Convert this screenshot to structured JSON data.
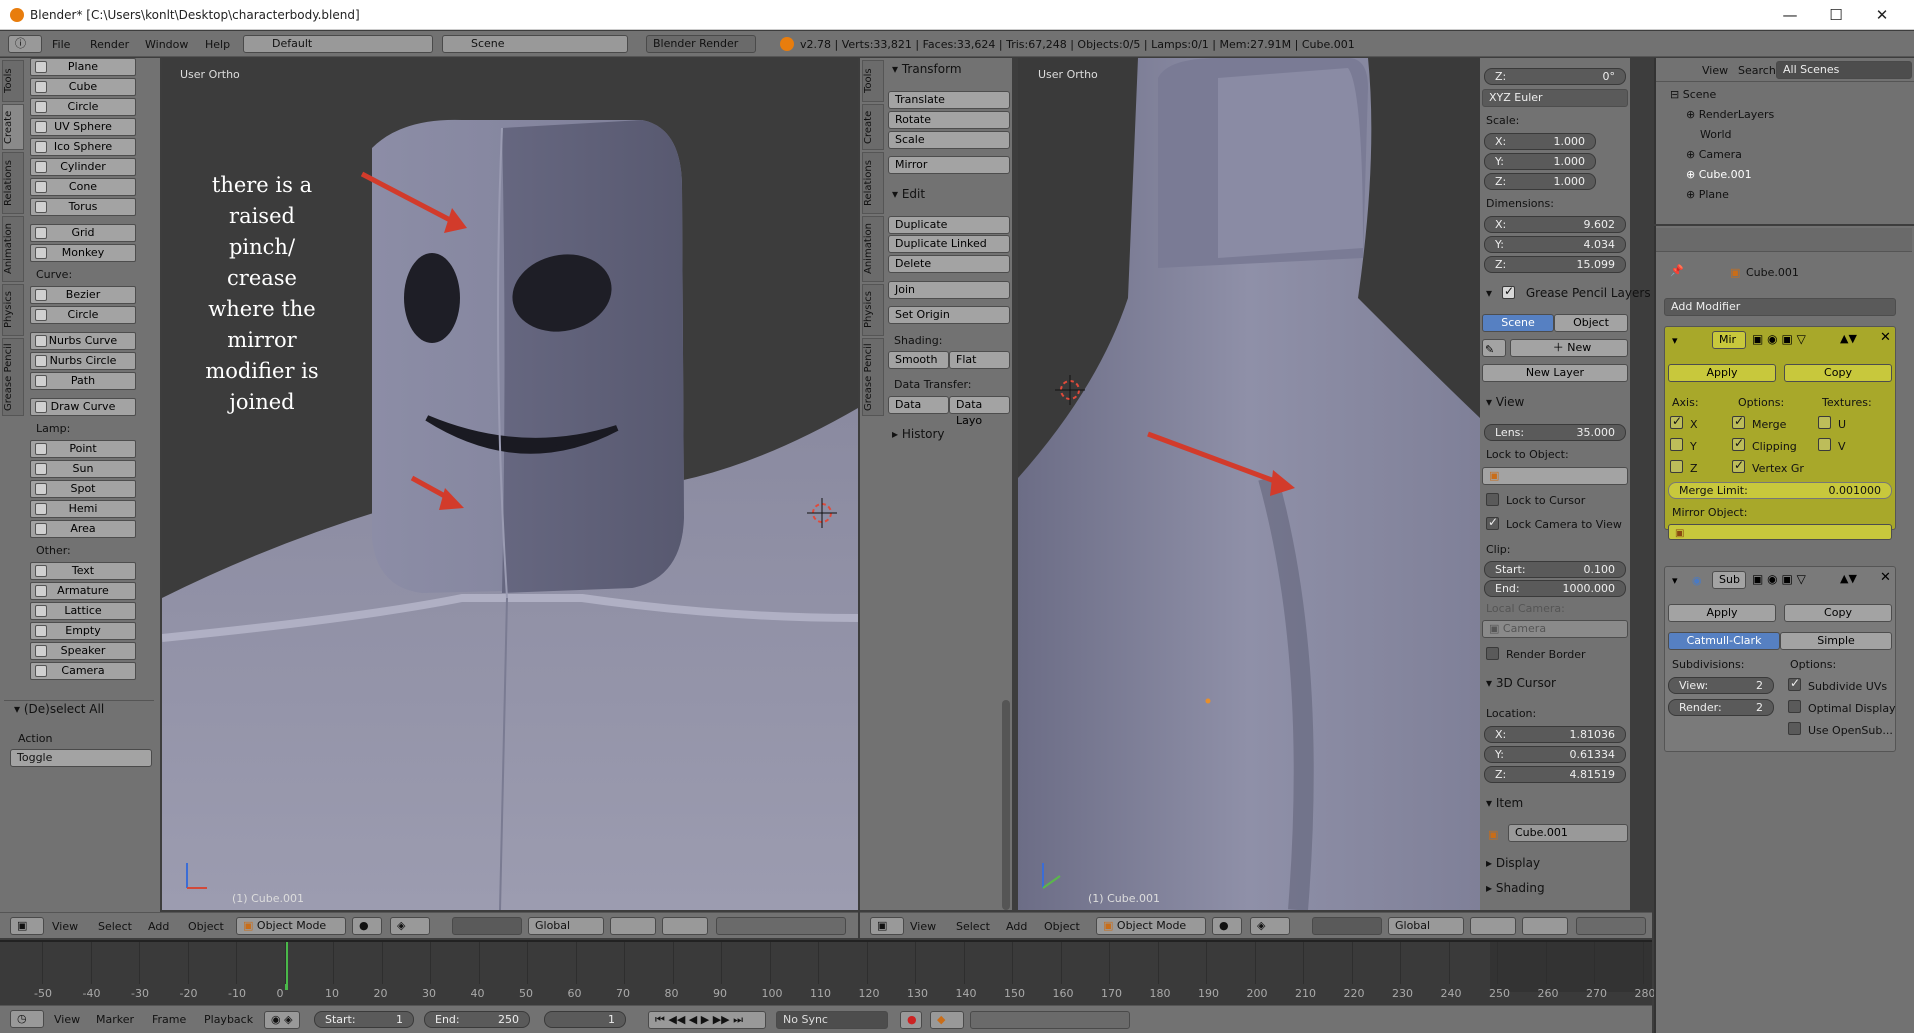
{
  "window": {
    "title": "Blender* [C:\\Users\\konlt\\Desktop\\characterbody.blend]",
    "controls": [
      "—",
      "☐",
      "✕"
    ]
  },
  "menubar": {
    "menus": [
      "File",
      "Render",
      "Window",
      "Help"
    ],
    "layout": "Default",
    "scene": "Scene",
    "engine": "Blender Render",
    "stats": "v2.78 | Verts:33,821 | Faces:33,624 | Tris:67,248 | Objects:0/5 | Lamps:0/1 | Mem:27.91M | Cube.001"
  },
  "left_tabs": [
    "Tools",
    "Create",
    "Relations",
    "Animation",
    "Physics",
    "Grease Pencil"
  ],
  "create_tools": {
    "mesh": [
      "Plane",
      "Cube",
      "Circle",
      "UV Sphere",
      "Ico Sphere",
      "Cylinder",
      "Cone",
      "Torus",
      "Grid",
      "Monkey"
    ],
    "curve_label": "Curve:",
    "curve": [
      "Bezier",
      "Circle",
      "Nurbs Curve",
      "Nurbs Circle",
      "Path",
      "Draw Curve"
    ],
    "lamp_label": "Lamp:",
    "lamp": [
      "Point",
      "Sun",
      "Spot",
      "Hemi",
      "Area"
    ],
    "other_label": "Other:",
    "other": [
      "Text",
      "Armature",
      "Lattice",
      "Empty",
      "Speaker",
      "Camera"
    ]
  },
  "operator": {
    "title": "(De)select All",
    "action_label": "Action",
    "action_value": "Toggle"
  },
  "viewport_left": {
    "label": "User Ortho",
    "object": "(1) Cube.001",
    "annotation": [
      "there is a",
      "raised",
      "pinch/",
      "crease",
      "where the",
      "mirror",
      "modifier is",
      "joined"
    ]
  },
  "viewport_right": {
    "label": "User Ortho",
    "object": "(1) Cube.001"
  },
  "tools_panel": {
    "transform_title": "Transform",
    "transform": [
      "Translate",
      "Rotate",
      "Scale",
      "Mirror"
    ],
    "edit_title": "Edit",
    "edit": [
      "Duplicate",
      "Duplicate Linked",
      "Delete",
      "Join",
      "Set Origin"
    ],
    "shading_label": "Shading:",
    "smooth": "Smooth",
    "flat": "Flat",
    "transfer_label": "Data Transfer:",
    "data": "Data",
    "data_layout": "Data Layo",
    "history": "History"
  },
  "props_n": {
    "z_top": "Z:",
    "z_deg": "0°",
    "euler": "XYZ Euler",
    "scale_label": "Scale:",
    "scale": [
      {
        "k": "X:",
        "v": "1.000"
      },
      {
        "k": "Y:",
        "v": "1.000"
      },
      {
        "k": "Z:",
        "v": "1.000"
      }
    ],
    "dim_label": "Dimensions:",
    "dim": [
      {
        "k": "X:",
        "v": "9.602"
      },
      {
        "k": "Y:",
        "v": "4.034"
      },
      {
        "k": "Z:",
        "v": "15.099"
      }
    ],
    "gp_title": "Grease Pencil Layers",
    "gp_scene": "Scene",
    "gp_object": "Object",
    "gp_new": "New",
    "gp_new_layer": "New Layer",
    "view_title": "View",
    "lens_k": "Lens:",
    "lens_v": "35.000",
    "lock_obj": "Lock to Object:",
    "lock_cursor": "Lock to Cursor",
    "lock_cam": "Lock Camera to View",
    "clip": "Clip:",
    "clip_start_k": "Start:",
    "clip_start_v": "0.100",
    "clip_end_k": "End:",
    "clip_end_v": "1000.000",
    "local_cam": "Local Camera:",
    "camera": "Camera",
    "render_border": "Render Border",
    "cursor_title": "3D Cursor",
    "location": "Location:",
    "loc": [
      {
        "k": "X:",
        "v": "1.81036"
      },
      {
        "k": "Y:",
        "v": "0.61334"
      },
      {
        "k": "Z:",
        "v": "4.81519"
      }
    ],
    "item_title": "Item",
    "item_name": "Cube.001",
    "display": "Display",
    "shading": "Shading"
  },
  "outliner": {
    "view": "View",
    "search": "Search",
    "all_scenes": "All Scenes",
    "tree": [
      "Scene",
      "RenderLayers",
      "World",
      "Camera",
      "Cube.001",
      "Plane"
    ]
  },
  "properties": {
    "object": "Cube.001",
    "add_modifier": "Add Modifier",
    "mirror": {
      "name": "Mir",
      "apply": "Apply",
      "copy": "Copy",
      "axis": "Axis:",
      "options": "Options:",
      "textures": "Textures:",
      "x": "X",
      "y": "Y",
      "z": "Z",
      "merge": "Merge",
      "clipping": "Clipping",
      "vertex": "Vertex Gr",
      "u": "U",
      "v": "V",
      "merge_limit_k": "Merge Limit:",
      "merge_limit_v": "0.001000",
      "mirror_object": "Mirror Object:"
    },
    "subsurf": {
      "name": "Sub",
      "apply": "Apply",
      "copy": "Copy",
      "catmull": "Catmull-Clark",
      "simple": "Simple",
      "subdiv": "Subdivisions:",
      "options": "Options:",
      "view_k": "View:",
      "view_v": "2",
      "render_k": "Render:",
      "render_v": "2",
      "uvs": "Subdivide UVs",
      "optimal": "Optimal Display",
      "opensub": "Use OpenSub..."
    }
  },
  "viewport_headers": {
    "view": "View",
    "select": "Select",
    "add": "Add",
    "object": "Object",
    "mode": "Object Mode",
    "global": "Global"
  },
  "timeline": {
    "ticks": [
      "-50",
      "-40",
      "-30",
      "-20",
      "-10",
      "0",
      "10",
      "20",
      "30",
      "40",
      "50",
      "60",
      "70",
      "80",
      "90",
      "100",
      "110",
      "120",
      "130",
      "140",
      "150",
      "160",
      "170",
      "180",
      "190",
      "200",
      "210",
      "220",
      "230",
      "240",
      "250",
      "260",
      "270",
      "280"
    ],
    "view": "View",
    "marker": "Marker",
    "frame": "Frame",
    "playback": "Playback",
    "start_k": "Start:",
    "start_v": "1",
    "end_k": "End:",
    "end_v": "250",
    "current": "1",
    "sync": "No Sync"
  }
}
